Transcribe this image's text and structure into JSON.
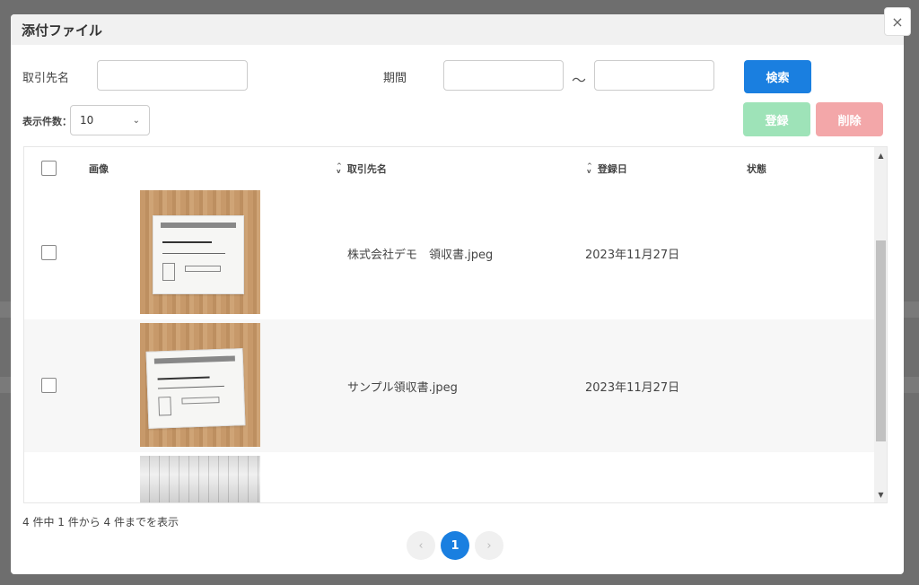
{
  "modal": {
    "title": "添付ファイル",
    "close_icon": "×"
  },
  "filters": {
    "client_label": "取引先名",
    "client_value": "",
    "period_label": "期間",
    "period_from": "",
    "period_to": "",
    "tilde": "〜",
    "search_label": "検索"
  },
  "display": {
    "count_label": "表示件数：",
    "count_value": "10"
  },
  "actions": {
    "register_label": "登録",
    "delete_label": "削除"
  },
  "table": {
    "columns": {
      "image": "画像",
      "client": "取引先名",
      "date": "登録日",
      "status": "状態"
    },
    "rows": [
      {
        "name": "株式会社デモ　領収書.jpeg",
        "date": "2023年11月27日",
        "status": ""
      },
      {
        "name": "サンプル領収書.jpeg",
        "date": "2023年11月27日",
        "status": ""
      }
    ]
  },
  "footer": {
    "summary": "4 件中 1 件から 4 件までを表示",
    "prev": "‹",
    "page": "1",
    "next": "›"
  },
  "colors": {
    "primary": "#1a7fe0",
    "register": "#9ee3b8",
    "delete": "#f3a7a9"
  }
}
